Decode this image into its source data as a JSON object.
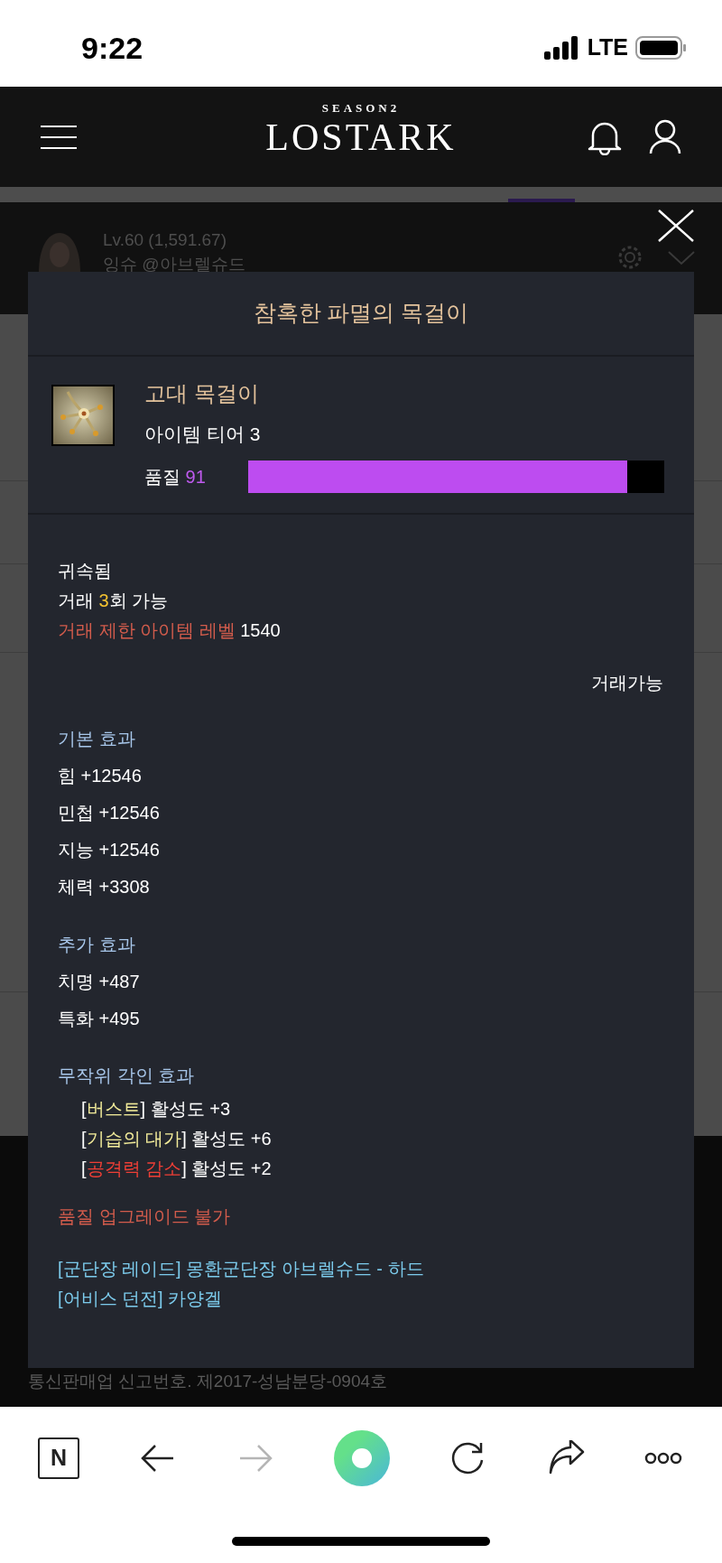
{
  "status_bar": {
    "time": "9:22",
    "network": "LTE"
  },
  "header": {
    "logo": {
      "subtitle": "SEASON2",
      "title": "LOSTARK"
    }
  },
  "profile": {
    "level": "Lv.60 (1,591.67)",
    "name": "잉슈 @아브렐슈드"
  },
  "tooltip": {
    "title": "참혹한 파멸의 목걸이",
    "grade_name": "고대 목걸이",
    "tier": "아이템 티어 3",
    "quality": {
      "label": "품질",
      "value": "91",
      "level": 0.91
    },
    "trade_lines": [
      [
        {
          "kind": "plain",
          "text": "귀속됨"
        }
      ],
      [
        {
          "kind": "plain",
          "text": "거래 "
        },
        {
          "kind": "count",
          "text": "3"
        },
        {
          "kind": "plain",
          "text": "회 가능"
        }
      ],
      [
        {
          "kind": "warn",
          "text": "거래 제한 아이템 레벨"
        },
        {
          "kind": "plain",
          "text": " 1540"
        }
      ]
    ],
    "trade_status": "거래가능",
    "sections": [
      {
        "heading": "기본 효과",
        "lines": [
          [
            {
              "kind": "plain",
              "text": "힘 +12546"
            }
          ],
          [
            {
              "kind": "plain",
              "text": "민첩 +12546"
            }
          ],
          [
            {
              "kind": "plain",
              "text": "지능 +12546"
            }
          ],
          [
            {
              "kind": "plain",
              "text": "체력 +3308"
            }
          ]
        ]
      },
      {
        "heading": "추가 효과",
        "lines": [
          [
            {
              "kind": "plain",
              "text": "치명 +487"
            }
          ],
          [
            {
              "kind": "plain",
              "text": "특화 +495"
            }
          ]
        ]
      },
      {
        "heading": "무작위 각인 효과",
        "indented": true,
        "lines": [
          [
            {
              "kind": "plain",
              "text": "["
            },
            {
              "kind": "buff",
              "text": "버스트"
            },
            {
              "kind": "plain",
              "text": "] 활성도 +3"
            }
          ],
          [
            {
              "kind": "plain",
              "text": "["
            },
            {
              "kind": "buff",
              "text": "기습의 대가"
            },
            {
              "kind": "plain",
              "text": "] 활성도 +6"
            }
          ],
          [
            {
              "kind": "plain",
              "text": "["
            },
            {
              "kind": "debuff",
              "text": "공격력 감소"
            },
            {
              "kind": "plain",
              "text": "] 활성도 +2"
            }
          ]
        ]
      }
    ],
    "quality_note": "품질 업그레이드 불가",
    "sources": [
      "[군단장 레이드] 몽환군단장 아브렐슈드 - 하드",
      "[어비스 던전] 카양겔"
    ]
  },
  "footer": "통신판매업 신고번호. 제2017-성남분당-0904호",
  "toolbar": [
    {
      "kind": "n-logo",
      "label": "N",
      "disabled": false
    },
    {
      "kind": "back",
      "disabled": false
    },
    {
      "kind": "forward",
      "disabled": true
    },
    {
      "kind": "home",
      "disabled": false
    },
    {
      "kind": "refresh",
      "disabled": false
    },
    {
      "kind": "share",
      "disabled": false
    },
    {
      "kind": "more",
      "disabled": false
    }
  ]
}
